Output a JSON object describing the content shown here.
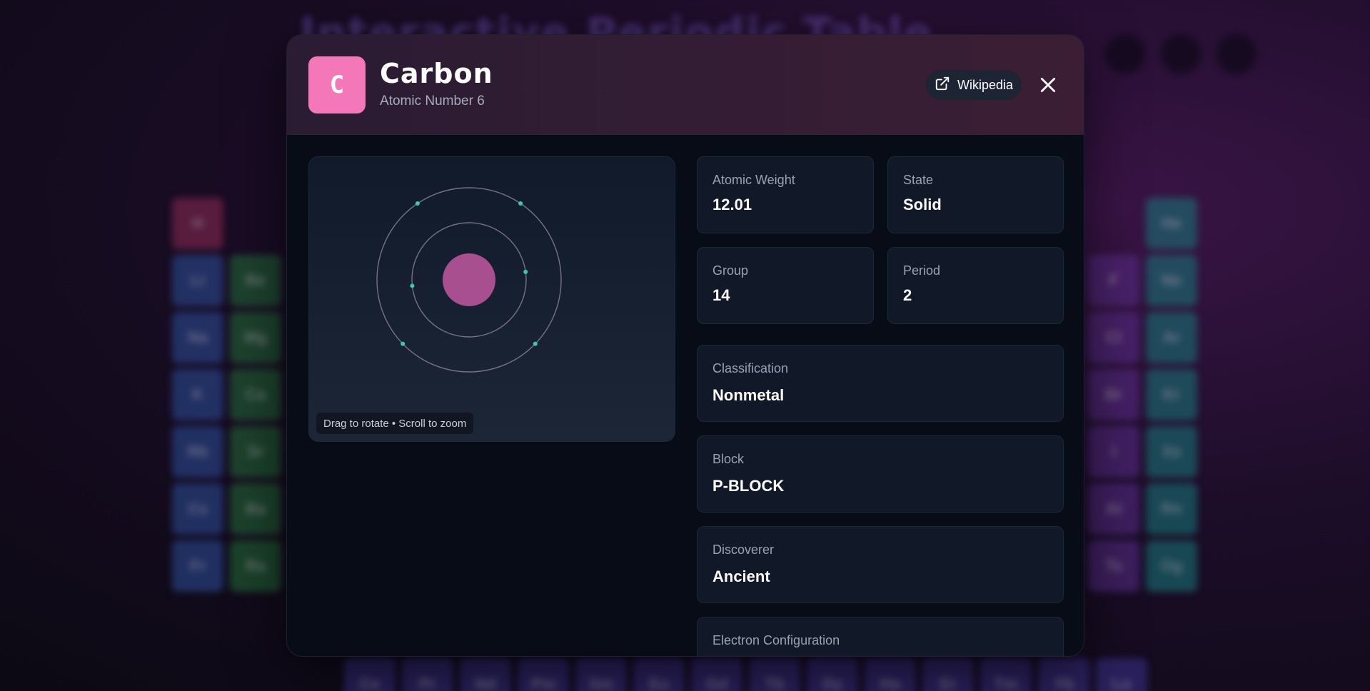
{
  "background": {
    "title": "Interactive Periodic Table",
    "cells": [
      {
        "symbol": "H",
        "class": "c-h"
      },
      {
        "symbol": "Li",
        "class": "c-alk"
      },
      {
        "symbol": "Be",
        "class": "c-ae"
      },
      {
        "symbol": "Na",
        "class": "c-alk"
      },
      {
        "symbol": "Mg",
        "class": "c-ae"
      },
      {
        "symbol": "K",
        "class": "c-alk"
      },
      {
        "symbol": "Ca",
        "class": "c-ae"
      },
      {
        "symbol": "Rb",
        "class": "c-alk"
      },
      {
        "symbol": "Sr",
        "class": "c-ae"
      },
      {
        "symbol": "Cs",
        "class": "c-alk"
      },
      {
        "symbol": "Ba",
        "class": "c-ae"
      },
      {
        "symbol": "Fr",
        "class": "c-alk"
      },
      {
        "symbol": "Ra",
        "class": "c-ae"
      },
      {
        "symbol": "He",
        "class": "c-nob"
      },
      {
        "symbol": "F",
        "class": "c-hal"
      },
      {
        "symbol": "Ne",
        "class": "c-nob"
      },
      {
        "symbol": "Cl",
        "class": "c-hal"
      },
      {
        "symbol": "Ar",
        "class": "c-nob"
      },
      {
        "symbol": "Br",
        "class": "c-hal"
      },
      {
        "symbol": "Kr",
        "class": "c-nob"
      },
      {
        "symbol": "I",
        "class": "c-hal"
      },
      {
        "symbol": "Xe",
        "class": "c-nob"
      },
      {
        "symbol": "At",
        "class": "c-hal"
      },
      {
        "symbol": "Rn",
        "class": "c-nob"
      },
      {
        "symbol": "Ts",
        "class": "c-hal"
      },
      {
        "symbol": "Og",
        "class": "c-nob"
      },
      {
        "symbol": "Ce",
        "class": "c-lan"
      },
      {
        "symbol": "Pr",
        "class": "c-lan"
      },
      {
        "symbol": "Nd",
        "class": "c-lan"
      },
      {
        "symbol": "Pm",
        "class": "c-lan"
      },
      {
        "symbol": "Sm",
        "class": "c-lan"
      },
      {
        "symbol": "Eu",
        "class": "c-lan"
      },
      {
        "symbol": "Gd",
        "class": "c-lan"
      },
      {
        "symbol": "Tb",
        "class": "c-lan"
      },
      {
        "symbol": "Dy",
        "class": "c-lan"
      },
      {
        "symbol": "Ho",
        "class": "c-lan"
      },
      {
        "symbol": "Er",
        "class": "c-lan"
      },
      {
        "symbol": "Tm",
        "class": "c-lan"
      },
      {
        "symbol": "Yb",
        "class": "c-lan"
      },
      {
        "symbol": "Lu",
        "class": "c-lan"
      }
    ]
  },
  "modal": {
    "symbol": "C",
    "name": "Carbon",
    "subtitle": "Atomic Number 6",
    "accent_color": "#f477b9",
    "wikipedia_label": "Wikipedia",
    "viewer": {
      "hint": "Drag to rotate • Scroll to zoom",
      "electron_shells": [
        2,
        4
      ]
    },
    "properties": {
      "atomic_weight": {
        "label": "Atomic Weight",
        "value": "12.01"
      },
      "state": {
        "label": "State",
        "value": "Solid"
      },
      "group": {
        "label": "Group",
        "value": "14"
      },
      "period": {
        "label": "Period",
        "value": "2"
      },
      "classification": {
        "label": "Classification",
        "value": "Nonmetal"
      },
      "block": {
        "label": "Block",
        "value": "P-BLOCK"
      },
      "discoverer": {
        "label": "Discoverer",
        "value": "Ancient"
      },
      "electron_configuration": {
        "label": "Electron Configuration",
        "value": ""
      }
    }
  }
}
